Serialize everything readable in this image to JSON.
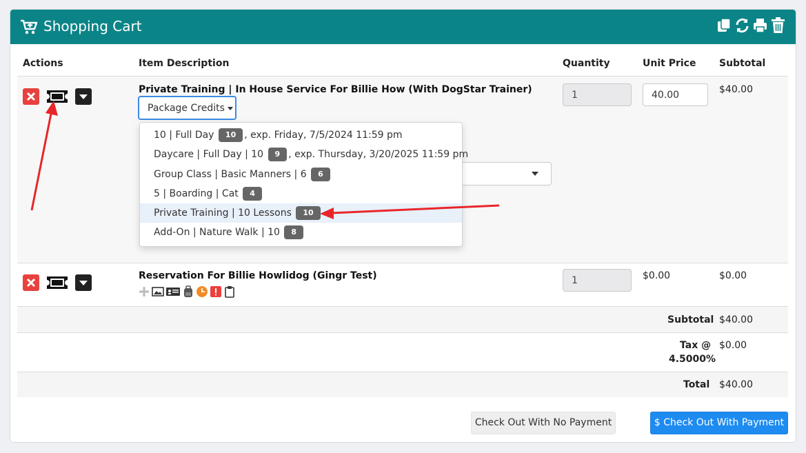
{
  "header": {
    "title": "Shopping Cart",
    "icons": [
      "copy-icon",
      "refresh-icon",
      "print-icon",
      "trash-icon"
    ],
    "color": "#0b8487"
  },
  "columns": {
    "actions": "Actions",
    "description": "Item Description",
    "quantity": "Quantity",
    "unit_price": "Unit Price",
    "subtotal": "Subtotal"
  },
  "rows": [
    {
      "title": "Private Training | In House Service For Billie How (With DogStar Trainer)",
      "package_button": "Package Credits",
      "quantity": "1",
      "unit_price": "40.00",
      "subtotal": "$40.00"
    },
    {
      "title": "Reservation For Billie Howlidog (Gingr Test)",
      "quantity": "1",
      "unit_price": "$0.00",
      "subtotal": "$0.00",
      "icons": [
        "plus-icon",
        "image-icon",
        "id-card-icon",
        "backpack-icon",
        "clock-icon",
        "alert-icon",
        "clipboard-icon"
      ]
    }
  ],
  "dropdown": {
    "items": [
      {
        "pre": "10 | Full Day",
        "badge": "10",
        "post": ", exp. Friday, 7/5/2024 11:59 pm"
      },
      {
        "pre": "Daycare | Full Day | 10",
        "badge": "9",
        "post": ", exp. Thursday, 3/20/2025 11:59 pm"
      },
      {
        "pre": "Group Class | Basic Manners | 6",
        "badge": "6",
        "post": ""
      },
      {
        "pre": "5 | Boarding | Cat",
        "badge": "4",
        "post": ""
      },
      {
        "pre": "Private Training | 10 Lessons",
        "badge": "10",
        "post": ""
      },
      {
        "pre": "Add-On | Nature Walk | 10",
        "badge": "8",
        "post": ""
      }
    ],
    "highlighted_index": 4
  },
  "totals": {
    "subtotal_label": "Subtotal",
    "subtotal_value": "$40.00",
    "tax_label_1": "Tax @",
    "tax_label_2": "4.5000%",
    "tax_value": "$0.00",
    "total_label": "Total",
    "total_value": "$40.00"
  },
  "buttons": {
    "no_payment": "Check Out With No Payment",
    "with_payment": "$ Check Out With Payment"
  },
  "colors": {
    "annotation_arrow": "#e8262a",
    "primary_button": "#1e8bf0",
    "remove_button": "#e8413e"
  }
}
